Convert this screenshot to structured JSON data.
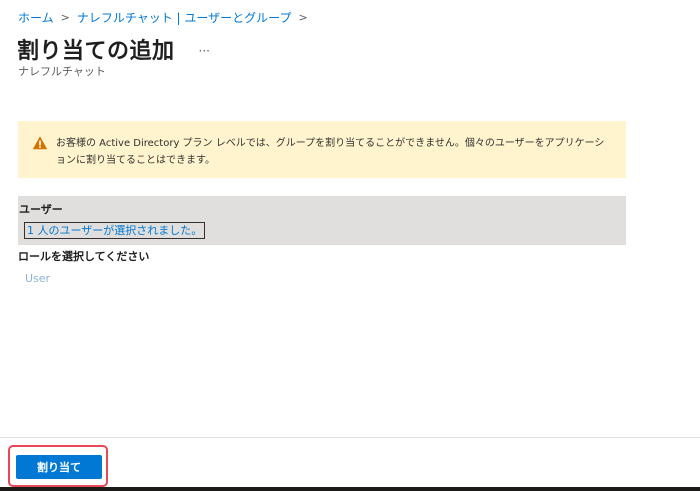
{
  "breadcrumb": {
    "items": [
      {
        "label": "ホーム"
      },
      {
        "label": "ナレフルチャット | ユーザーとグループ"
      }
    ],
    "separator": ">"
  },
  "header": {
    "title": "割り当ての追加",
    "more_icon": "ellipsis-icon",
    "more_label": "···",
    "subtitle": "ナレフルチャット"
  },
  "warning": {
    "icon": "warning-icon",
    "line1": "お客様の Active Directory プラン レベルでは、グループを割り当てることができません。個々のユーザーをアプリケーシ",
    "line2": "ョンに割り当てることはできます。",
    "color": "#fff4ce"
  },
  "users": {
    "label": "ユーザー",
    "selected_text": "1 人のユーザーが選択されました。"
  },
  "role": {
    "label": "ロールを選択してください",
    "value": "User"
  },
  "footer": {
    "assign_label": "割り当て"
  },
  "colors": {
    "accent": "#0078d4",
    "highlight": "#e74856",
    "warning_bg": "#fff4ce",
    "section_bg": "#e1dfdd"
  }
}
